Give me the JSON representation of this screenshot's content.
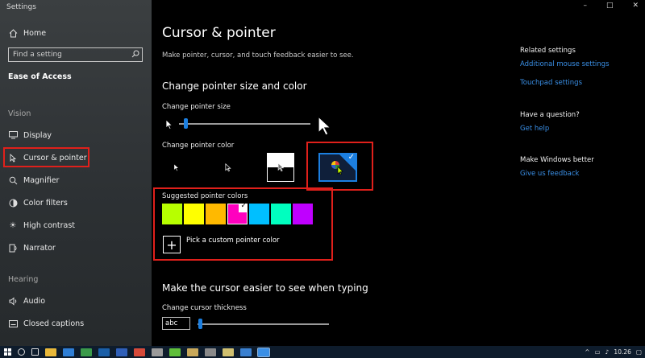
{
  "window": {
    "title": "Settings",
    "controls": [
      "–",
      "□",
      "✕"
    ]
  },
  "sidebar": {
    "home": "Home",
    "search_placeholder": "Find a setting",
    "section": "Ease of Access",
    "groups": [
      {
        "label": "Vision",
        "items": [
          {
            "label": "Display",
            "icon": "display-icon"
          },
          {
            "label": "Cursor & pointer",
            "icon": "cursor-icon",
            "selected": true
          },
          {
            "label": "Magnifier",
            "icon": "magnifier-icon"
          },
          {
            "label": "Color filters",
            "icon": "color-filters-icon"
          },
          {
            "label": "High contrast",
            "icon": "high-contrast-icon"
          },
          {
            "label": "Narrator",
            "icon": "narrator-icon"
          }
        ]
      },
      {
        "label": "Hearing",
        "items": [
          {
            "label": "Audio",
            "icon": "speaker-icon"
          },
          {
            "label": "Closed captions",
            "icon": "captions-icon"
          }
        ]
      }
    ]
  },
  "main": {
    "title": "Cursor & pointer",
    "subtitle": "Make pointer, cursor, and touch feedback easier to see.",
    "section1": "Change pointer size and color",
    "size_label": "Change pointer size",
    "size_value": 0.05,
    "color_label": "Change pointer color",
    "color_options": [
      "white",
      "black",
      "inverted",
      "custom"
    ],
    "selected_color_option": "custom",
    "suggested_label": "Suggested pointer colors",
    "suggested_colors": [
      "#b7ff00",
      "#ffff00",
      "#ffb900",
      "#ff00bf",
      "#00bfff",
      "#00ffbf",
      "#bf00ff"
    ],
    "selected_suggested": 3,
    "pick_custom": "Pick a custom pointer color",
    "section2": "Make the cursor easier to see when typing",
    "thickness_label": "Change cursor thickness",
    "thickness_preview": "abc",
    "thickness_value": 0.02
  },
  "related": {
    "head1": "Related settings",
    "link1": "Additional mouse settings",
    "link2": "Touchpad settings",
    "head2": "Have a question?",
    "link3": "Get help",
    "head3": "Make Windows better",
    "link4": "Give us feedback"
  },
  "taskbar": {
    "time": "10.26",
    "icons": [
      "search-icon",
      "task-view-icon",
      "explorer-icon",
      "edge-icon",
      "store-icon",
      "photoshop-icon",
      "word-icon",
      "chrome-icon",
      "app-icon",
      "dreamweaver-icon",
      "app-icon",
      "app-icon",
      "app-icon",
      "mail-icon",
      "settings-icon"
    ]
  }
}
